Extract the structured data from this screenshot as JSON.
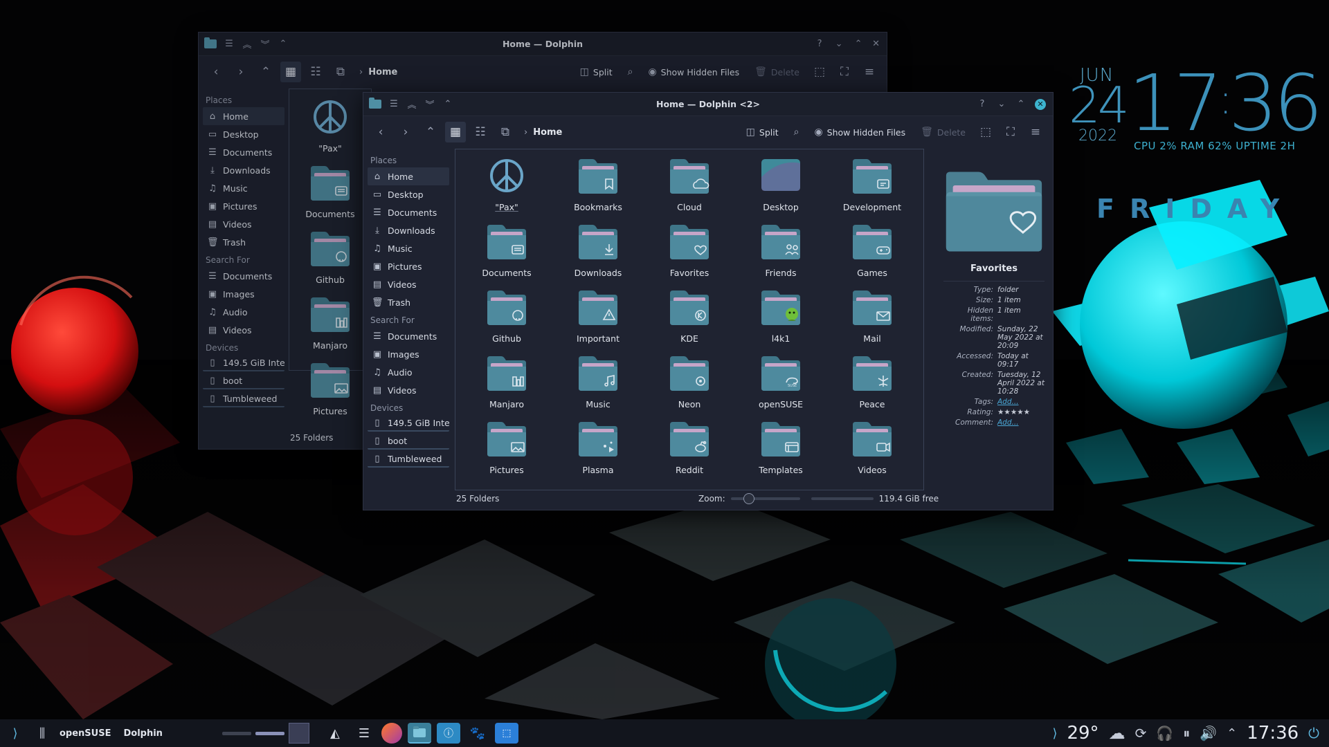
{
  "desktop": {
    "clock": {
      "month": "JUN",
      "day": "24",
      "year": "2022",
      "time_hours": "17",
      "time_minutes": "36",
      "stats": "CPU 2% RAM 62% UPTIME 2H",
      "weekday": "FRIDAY"
    }
  },
  "back_window": {
    "title": "Home — Dolphin",
    "breadcrumb": "Home",
    "toolbar": {
      "split": "Split",
      "hidden": "Show Hidden Files",
      "delete": "Delete"
    },
    "folders": [
      "\"Pax\"",
      "Documents",
      "Github",
      "Manjaro",
      "Pictures"
    ],
    "status": "25 Folders"
  },
  "window": {
    "title": "Home — Dolphin <2>",
    "breadcrumb": "Home",
    "toolbar": {
      "split": "Split",
      "hidden": "Show Hidden Files",
      "delete": "Delete"
    },
    "sidebar": {
      "places_label": "Places",
      "places": [
        {
          "label": "Home",
          "icon": "home-icon"
        },
        {
          "label": "Desktop",
          "icon": "desktop-icon"
        },
        {
          "label": "Documents",
          "icon": "documents-icon"
        },
        {
          "label": "Downloads",
          "icon": "downloads-icon"
        },
        {
          "label": "Music",
          "icon": "music-icon"
        },
        {
          "label": "Pictures",
          "icon": "pictures-icon"
        },
        {
          "label": "Videos",
          "icon": "videos-icon"
        },
        {
          "label": "Trash",
          "icon": "trash-icon"
        }
      ],
      "search_label": "Search For",
      "search": [
        {
          "label": "Documents"
        },
        {
          "label": "Images"
        },
        {
          "label": "Audio"
        },
        {
          "label": "Videos"
        }
      ],
      "devices_label": "Devices",
      "devices": [
        {
          "label": "149.5 GiB Inte..."
        },
        {
          "label": "boot"
        },
        {
          "label": "Tumbleweed"
        }
      ]
    },
    "folders": [
      {
        "label": "\"Pax\"",
        "emblem": "peace"
      },
      {
        "label": "Bookmarks",
        "emblem": "bookmark"
      },
      {
        "label": "Cloud",
        "emblem": "cloud"
      },
      {
        "label": "Desktop",
        "emblem": "desktop"
      },
      {
        "label": "Development",
        "emblem": "dev"
      },
      {
        "label": "Documents",
        "emblem": "doc"
      },
      {
        "label": "Downloads",
        "emblem": "download"
      },
      {
        "label": "Favorites",
        "emblem": "heart"
      },
      {
        "label": "Friends",
        "emblem": "friends"
      },
      {
        "label": "Games",
        "emblem": "game"
      },
      {
        "label": "Github",
        "emblem": "github"
      },
      {
        "label": "Important",
        "emblem": "warning"
      },
      {
        "label": "KDE",
        "emblem": "kde"
      },
      {
        "label": "l4k1",
        "emblem": "avatar"
      },
      {
        "label": "Mail",
        "emblem": "mail"
      },
      {
        "label": "Manjaro",
        "emblem": "manjaro"
      },
      {
        "label": "Music",
        "emblem": "music"
      },
      {
        "label": "Neon",
        "emblem": "neon"
      },
      {
        "label": "openSUSE",
        "emblem": "suse"
      },
      {
        "label": "Peace",
        "emblem": "leaf"
      },
      {
        "label": "Pictures",
        "emblem": "picture"
      },
      {
        "label": "Plasma",
        "emblem": "plasma"
      },
      {
        "label": "Reddit",
        "emblem": "reddit"
      },
      {
        "label": "Templates",
        "emblem": "template"
      },
      {
        "label": "Videos",
        "emblem": "video"
      }
    ],
    "info": {
      "title": "Favorites",
      "rows": [
        {
          "k": "Type:",
          "v": "folder"
        },
        {
          "k": "Size:",
          "v": "1 item"
        },
        {
          "k": "Hidden items:",
          "v": "1 item"
        },
        {
          "k": "Modified:",
          "v": "Sunday, 22 May 2022 at 20:09"
        },
        {
          "k": "Accessed:",
          "v": "Today at 09:17"
        },
        {
          "k": "Created:",
          "v": "Tuesday, 12 April 2022 at 10:28"
        },
        {
          "k": "Tags:",
          "v": "Add..."
        },
        {
          "k": "Rating:",
          "v": "★★★★★"
        },
        {
          "k": "Comment:",
          "v": "Add..."
        }
      ]
    },
    "status": {
      "count": "25 Folders",
      "zoom_label": "Zoom:",
      "free": "119.4 GiB free"
    }
  },
  "taskbar": {
    "distro_label": "openSUSE",
    "app_label": "Dolphin",
    "temperature": "29°",
    "time": "17:36"
  }
}
